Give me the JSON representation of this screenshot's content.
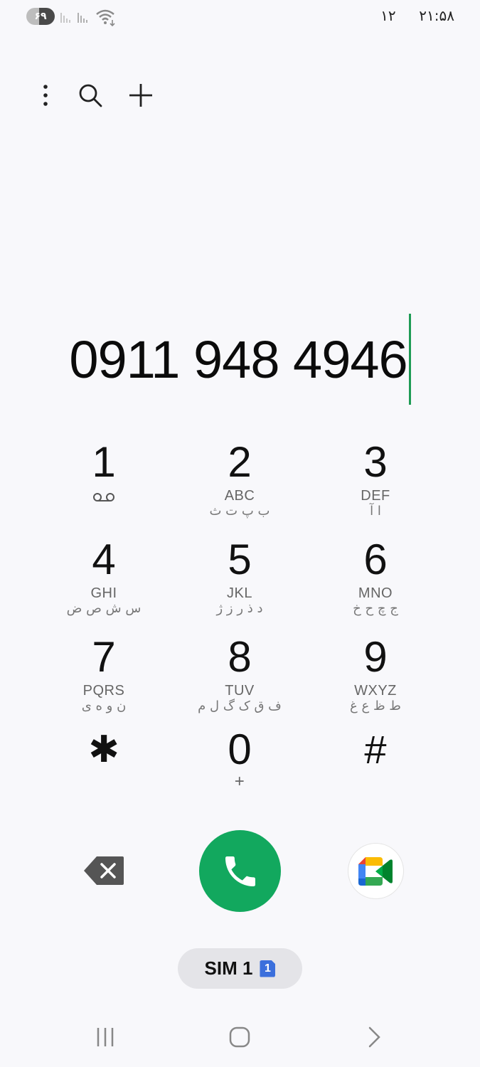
{
  "status": {
    "battery": "۶۹",
    "time": "۲۱:۵۸",
    "date": "۱۲"
  },
  "toolbar": {
    "icons": [
      "more-options-icon",
      "search-icon",
      "add-icon"
    ]
  },
  "dialer": {
    "number": "0911 948 4946"
  },
  "keypad": [
    {
      "digit": "1",
      "latin": "",
      "farsi": ""
    },
    {
      "digit": "2",
      "latin": "ABC",
      "farsi": "ب پ ت ث"
    },
    {
      "digit": "3",
      "latin": "DEF",
      "farsi": "ا آ"
    },
    {
      "digit": "4",
      "latin": "GHI",
      "farsi": "س ش ص ض"
    },
    {
      "digit": "5",
      "latin": "JKL",
      "farsi": "د ذ ر ز ژ"
    },
    {
      "digit": "6",
      "latin": "MNO",
      "farsi": "ج چ ح خ"
    },
    {
      "digit": "7",
      "latin": "PQRS",
      "farsi": "ن و ه ی"
    },
    {
      "digit": "8",
      "latin": "TUV",
      "farsi": "ف ق ک گ ل م"
    },
    {
      "digit": "9",
      "latin": "WXYZ",
      "farsi": "ط ظ ع غ"
    },
    {
      "digit": "✱",
      "latin": "",
      "farsi": ""
    },
    {
      "digit": "0",
      "latin": "+",
      "farsi": ""
    },
    {
      "digit": "#",
      "latin": "",
      "farsi": ""
    }
  ],
  "sim": {
    "label": "SIM 1",
    "badge": "1"
  },
  "colors": {
    "call": "#12a85e",
    "cursor": "#1e9b55",
    "sim_badge": "#3b6fdc"
  }
}
